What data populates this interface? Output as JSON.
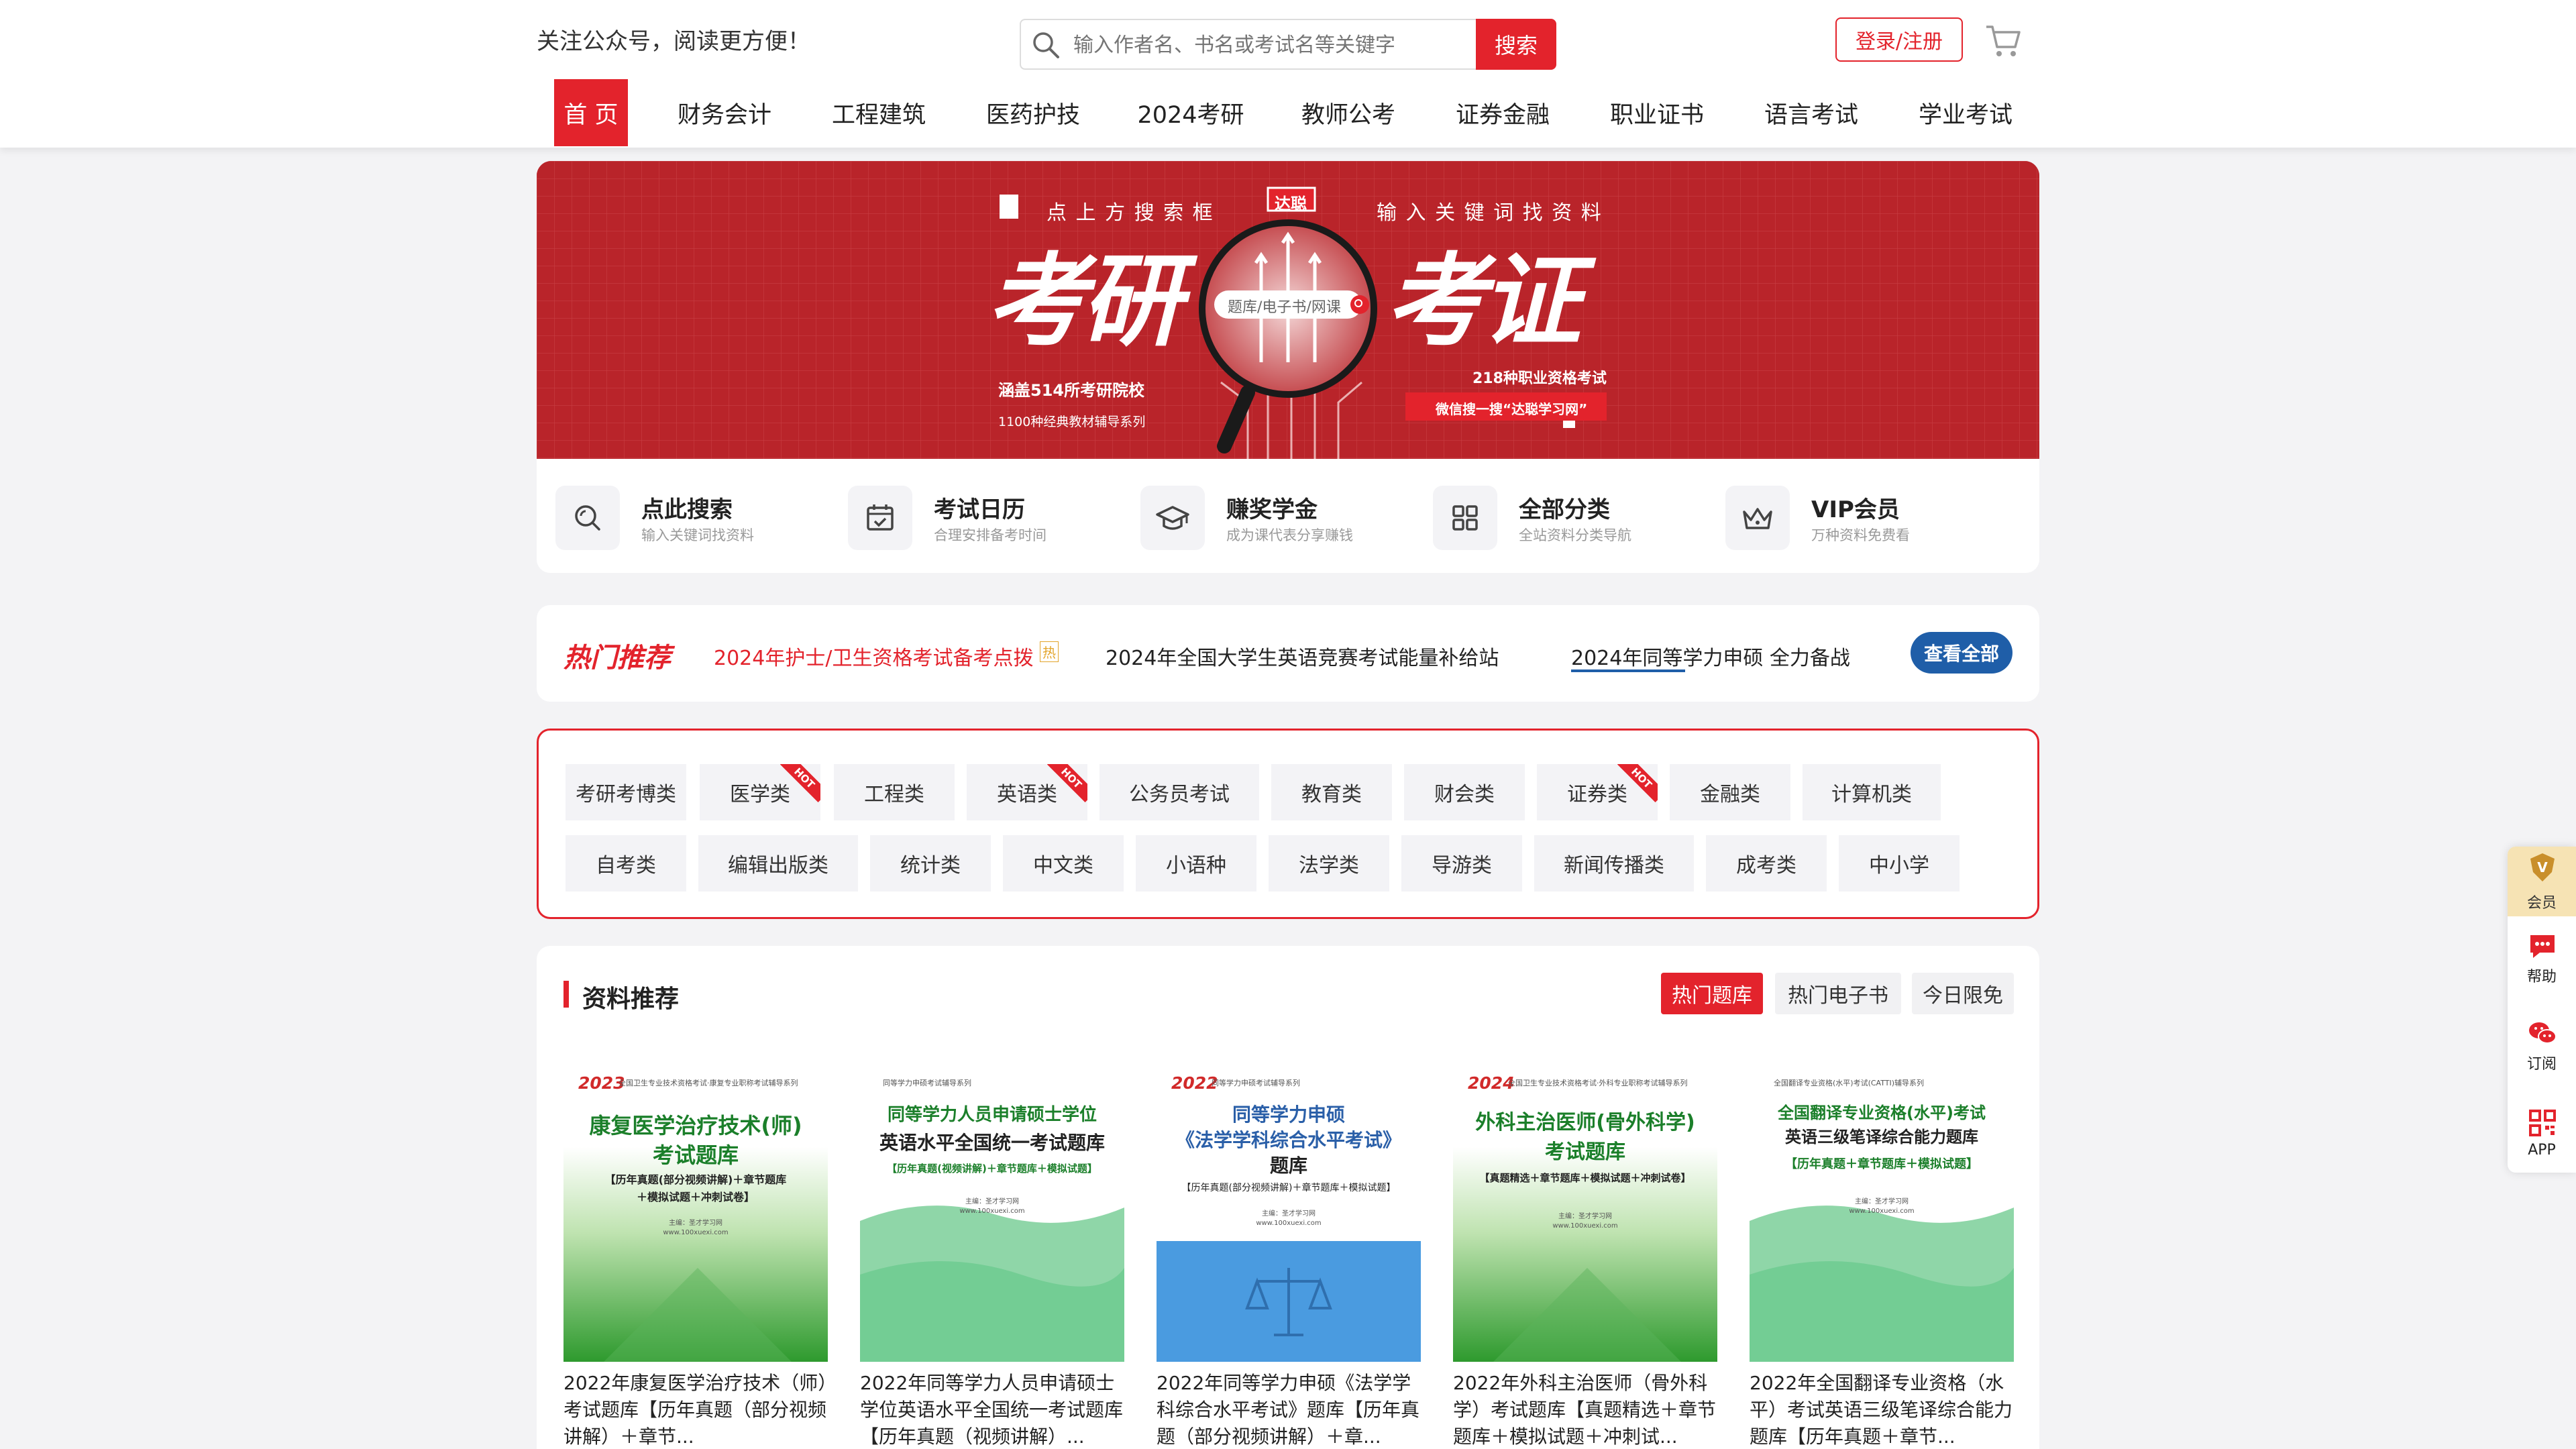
{
  "header": {
    "slogan": "关注公众号，阅读更方便！",
    "search_placeholder": "输入作者名、书名或考试名等关键字",
    "search_button": "搜索",
    "login_label": "登录/注册"
  },
  "nav": [
    "首 页",
    "财务会计",
    "工程建筑",
    "医药护技",
    "2024考研",
    "教师公考",
    "证券金融",
    "职业证书",
    "语言考试",
    "学业考试"
  ],
  "banner": {
    "top_left": "点 上 方 搜 索 框",
    "top_right": "输 入 关 键 词 找 资 料",
    "badge": "达聪",
    "big_left": "考研",
    "big_right": "考证",
    "search_hint": "题库/电子书/网课",
    "left_line1": "涵盖514所考研院校",
    "left_line2": "1100种经典教材辅导系列",
    "right_line1": "218种职业资格考试",
    "right_line2": "微信搜一搜“达聪学习网”"
  },
  "features": [
    {
      "title": "点此搜索",
      "sub": "输入关键词找资料",
      "icon": "search-icon"
    },
    {
      "title": "考试日历",
      "sub": "合理安排备考时间",
      "icon": "calendar-icon"
    },
    {
      "title": "赚奖学金",
      "sub": "成为课代表分享赚钱",
      "icon": "graduation-cap-icon"
    },
    {
      "title": "全部分类",
      "sub": "全站资料分类导航",
      "icon": "grid-icon"
    },
    {
      "title": "VIP会员",
      "sub": "万种资料免费看",
      "icon": "crown-icon"
    }
  ],
  "hot": {
    "label": "热门推荐",
    "links": [
      "2024年护士/卫生资格考试备考点拨",
      "2024年全国大学生英语竞赛考试能量补给站",
      "2024年同等学力申硕 全力备战"
    ],
    "badge": "热",
    "view_all": "查看全部"
  },
  "categories": {
    "hot_badge": "HOT",
    "row1": [
      "考研考博类",
      "医学类",
      "工程类",
      "英语类",
      "公务员考试",
      "教育类",
      "财会类",
      "证券类",
      "金融类",
      "计算机类"
    ],
    "row2": [
      "自考类",
      "编辑出版类",
      "统计类",
      "中文类",
      "小语种",
      "法学类",
      "导游类",
      "新闻传播类",
      "成考类",
      "中小学"
    ],
    "hot_flags": [
      "医学类",
      "英语类",
      "证券类"
    ]
  },
  "recommend": {
    "title": "资料推荐",
    "tabs": [
      "热门题库",
      "热门电子书",
      "今日限免"
    ],
    "books": [
      {
        "year": "2023",
        "series": "全国卫生专业技术资格考试·康复专业职称考试辅导系列",
        "heading": [
          "康复医学治疗技术(师)",
          "考试题库"
        ],
        "sub": [
          "【历年真题(部分视频讲解)＋章节题库",
          "＋模拟试题＋冲刺试卷】"
        ],
        "author": [
          "主编：圣才学习网",
          "www.100xuexi.com"
        ],
        "title": "2022年康复医学治疗技术（师）考试题库【历年真题（部分视频讲解）＋章节..."
      },
      {
        "year": "",
        "series": "同等学力申硕考试辅导系列",
        "heading": [
          "同等学力人员申请硕士学位",
          "英语水平全国统一考试题库"
        ],
        "sub": [
          "【历年真题(视频讲解)＋章节题库＋模拟试题】"
        ],
        "author": [
          "主编：圣才学习网",
          "www.100xuexi.com"
        ],
        "title": "2022年同等学力人员申请硕士学位英语水平全国统一考试题库【历年真题（视频讲解）..."
      },
      {
        "year": "2022",
        "series": "同等学力申硕考试辅导系列",
        "heading": [
          "同等学力申硕",
          "《法学学科综合水平考试》",
          "题库"
        ],
        "sub": [
          "【历年真题(部分视频讲解)＋章节题库＋模拟试题】"
        ],
        "author": [
          "主编：圣才学习网",
          "www.100xuexi.com"
        ],
        "title": "2022年同等学力申硕《法学学科综合水平考试》题库【历年真题（部分视频讲解）＋章..."
      },
      {
        "year": "2024",
        "series": "全国卫生专业技术资格考试·外科专业职称考试辅导系列",
        "heading": [
          "外科主治医师(骨外科学)",
          "考试题库"
        ],
        "sub": [
          "【真题精选＋章节题库＋模拟试题＋冲刺试卷】"
        ],
        "author": [
          "主编：圣才学习网",
          "www.100xuexi.com"
        ],
        "title": "2022年外科主治医师（骨外科学）考试题库【真题精选＋章节题库＋模拟试题＋冲刺试..."
      },
      {
        "year": "",
        "series": "全国翻译专业资格(水平)考试(CATTI)辅导系列",
        "heading": [
          "全国翻译专业资格(水平)考试",
          "英语三级笔译综合能力题库"
        ],
        "sub": [
          "【历年真题＋章节题库＋模拟试题】"
        ],
        "author": [
          "主编：圣才学习网",
          "www.100xuexi.com"
        ],
        "title": "2022年全国翻译专业资格（水平）考试英语三级笔译综合能力题库【历年真题＋章节..."
      }
    ]
  },
  "sidebar": [
    {
      "label": "会员",
      "icon": "vip-crown-icon"
    },
    {
      "label": "帮助",
      "icon": "chat-icon"
    },
    {
      "label": "订阅",
      "icon": "wechat-icon"
    },
    {
      "label": "APP",
      "icon": "qr-code-icon"
    }
  ],
  "colors": {
    "accent": "#e3232c",
    "banner": "#b9242a",
    "blue": "#1f5ea8"
  }
}
